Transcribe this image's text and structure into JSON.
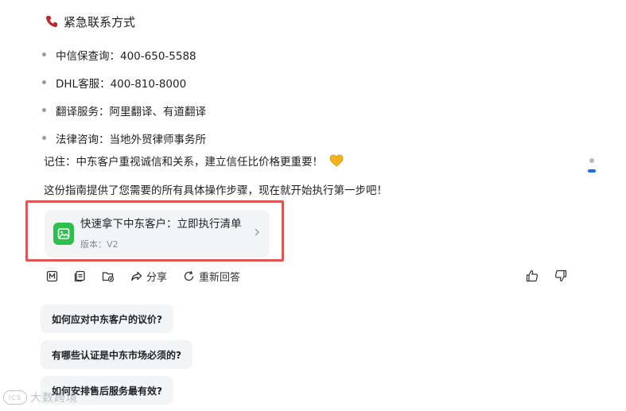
{
  "heading": {
    "icon": "phone-icon",
    "text": "紧急联系方式"
  },
  "contacts": [
    {
      "label": "中信保查询：400-650-5588"
    },
    {
      "label": "DHL客服：400-810-8000"
    },
    {
      "label": "翻译服务：阿里翻译、有道翻译"
    },
    {
      "label": "法律咨询：当地外贸律师事务所"
    }
  ],
  "paragraphs": {
    "remember": "记住：中东客户重视诚信和关系，建立信任比价格更重要！",
    "closing": "这份指南提供了您需要的所有具体操作步骤，现在就开始执行第一步吧！"
  },
  "card": {
    "title": "快速拿下中东客户：立即执行清单",
    "version": "版本：V2",
    "icon": "image-document-icon"
  },
  "actions": {
    "share": "分享",
    "regenerate": "重新回答"
  },
  "suggestions": [
    "如何应对中东客户的议价?",
    "有哪些认证是中东市场必须的?",
    "如何安排售后服务最有效?"
  ],
  "watermark": {
    "logo": "ICS",
    "text": "大数跨境"
  },
  "colors": {
    "accent": "#1a6ef5",
    "highlight_border": "#e35454",
    "card_icon": "#2fbf4f"
  }
}
